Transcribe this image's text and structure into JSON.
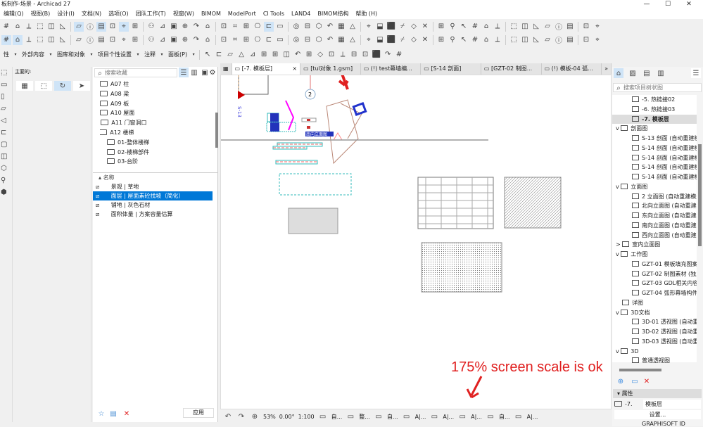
{
  "window": {
    "title": "板制作-场景 - Archicad 27",
    "controls": [
      "—",
      "☐",
      "✕"
    ]
  },
  "menu": [
    "编辑(Q)",
    "视图(B)",
    "设计(I)",
    "文档(N)",
    "选项(O)",
    "团队工作(T)",
    "视窗(W)",
    "BIMOM",
    "ModelPort",
    "CI Tools",
    "LAND4",
    "BIMOM结构",
    "帮助 (H)"
  ],
  "toolbar3": {
    "labels": [
      "性",
      "外部内容",
      "图库和对象",
      "项目个性设置",
      "注释",
      "面板(P)"
    ]
  },
  "info_box": {
    "label": "主要的:"
  },
  "library": {
    "search_placeholder": "搜索收藏",
    "folders": [
      {
        "label": "A07 柱",
        "indent": 1
      },
      {
        "label": "A08 梁",
        "indent": 1
      },
      {
        "label": "A09 板",
        "indent": 1
      },
      {
        "label": "A10 屋面",
        "indent": 1
      },
      {
        "label": "A11 门窗洞口",
        "indent": 1,
        "expander": ">"
      },
      {
        "label": "A12 楼梯",
        "indent": 1,
        "expander": "v"
      },
      {
        "label": "01-整体楼梯",
        "indent": 2
      },
      {
        "label": "02-楼梯部件",
        "indent": 2
      },
      {
        "label": "03-台阶",
        "indent": 2
      }
    ],
    "list_header": "名称",
    "items": [
      {
        "label": "景观 | 草地",
        "selected": false
      },
      {
        "label": "面层 | 屋面素砼找坡（简化）",
        "selected": true
      },
      {
        "label": "铺地 | 灰色石材",
        "selected": false
      },
      {
        "label": "面积体量 | 方案容量估算",
        "selected": false
      }
    ],
    "apply_label": "应用"
  },
  "tabs": [
    {
      "label": "[-7. 模板层]",
      "active": true,
      "close": "×"
    },
    {
      "label": "[tul对象 1.gsm]"
    },
    {
      "label": "(!) test幕墙编..."
    },
    {
      "label": "[S-14 剖面]"
    },
    {
      "label": "[GZT-02 制图..."
    },
    {
      "label": "(!) 模板-04 弧..."
    }
  ],
  "tabs_more": "»",
  "canvas": {
    "elevation_label": "南向立面图",
    "section_label": "S-13",
    "marker_number": "2"
  },
  "status": {
    "zoom": "53%",
    "angle": "0.00°",
    "scale": "1:100",
    "items": [
      "自...",
      "整...",
      "自...",
      "A|...",
      "A|...",
      "A|...",
      "自...",
      "A|..."
    ]
  },
  "navigator": {
    "search_placeholder": "搜索项目树状图",
    "rows": [
      {
        "label": "-5. 热链接02",
        "indent": 2,
        "icon": "story"
      },
      {
        "label": "-6. 热链接03",
        "indent": 2,
        "icon": "story"
      },
      {
        "label": "-7. 模板层",
        "indent": 2,
        "icon": "story",
        "selected": true
      },
      {
        "label": "剖面图",
        "indent": 1,
        "icon": "section",
        "expander": "v"
      },
      {
        "label": "S-13 剖面 (自动重建模型)",
        "indent": 2,
        "icon": "section"
      },
      {
        "label": "S-14 剖面 (自动重建模型)",
        "indent": 2,
        "icon": "section"
      },
      {
        "label": "S-14 剖面 (自动重建模型)",
        "indent": 2,
        "icon": "section"
      },
      {
        "label": "S-14 剖面 (自动重建模型)",
        "indent": 2,
        "icon": "section"
      },
      {
        "label": "S-14 剖面 (自动重建模型)",
        "indent": 2,
        "icon": "section"
      },
      {
        "label": "立面图",
        "indent": 1,
        "icon": "elevation",
        "expander": "v"
      },
      {
        "label": "2 立面图 (自动重建模型)",
        "indent": 2,
        "icon": "elevation"
      },
      {
        "label": "北向立面图 (自动重建模型)",
        "indent": 2,
        "icon": "elevation"
      },
      {
        "label": "东向立面图 (自动重建模型)",
        "indent": 2,
        "icon": "elevation"
      },
      {
        "label": "南向立面图 (自动重建模型)",
        "indent": 2,
        "icon": "elevation"
      },
      {
        "label": "西向立面图 (自动重建模型)",
        "indent": 2,
        "icon": "elevation"
      },
      {
        "label": "室内立面图",
        "indent": 1,
        "icon": "interior",
        "expander": ">"
      },
      {
        "label": "工作图",
        "indent": 1,
        "icon": "worksheet",
        "expander": "v"
      },
      {
        "label": "GZT-01 模板填充图案 (",
        "indent": 2,
        "icon": "worksheet"
      },
      {
        "label": "GZT-02 制图素材 (独立",
        "indent": 2,
        "icon": "worksheet"
      },
      {
        "label": "GZT-03 GDL相关内容 (",
        "indent": 2,
        "icon": "worksheet"
      },
      {
        "label": "GZT-04 弧形幕墙构件能",
        "indent": 2,
        "icon": "worksheet"
      },
      {
        "label": "详图",
        "indent": 1,
        "icon": "detail"
      },
      {
        "label": "3D文档",
        "indent": 1,
        "icon": "3d-doc",
        "expander": "v"
      },
      {
        "label": "3D-01 透视图 (自动重建",
        "indent": 2,
        "icon": "3d-doc"
      },
      {
        "label": "3D-02 透视图 (自动重建",
        "indent": 2,
        "icon": "3d-doc"
      },
      {
        "label": "3D-03 透视图 (自动重建",
        "indent": 2,
        "icon": "3d-doc"
      },
      {
        "label": "3D",
        "indent": 1,
        "icon": "3d",
        "expander": "v"
      },
      {
        "label": "普通透视图",
        "indent": 2,
        "icon": "3d"
      }
    ],
    "properties_header": "属性",
    "prop_id": "-7.",
    "prop_name": "模板层",
    "settings_label": "设置...",
    "brand": "GRAPHISOFT ID"
  },
  "annotation": {
    "text": "175% screen scale is ok",
    "color": "#e02020"
  },
  "colors": {
    "accent": "#0078d7",
    "selection_light": "#cfe4f7",
    "annotation": "#e02020"
  }
}
